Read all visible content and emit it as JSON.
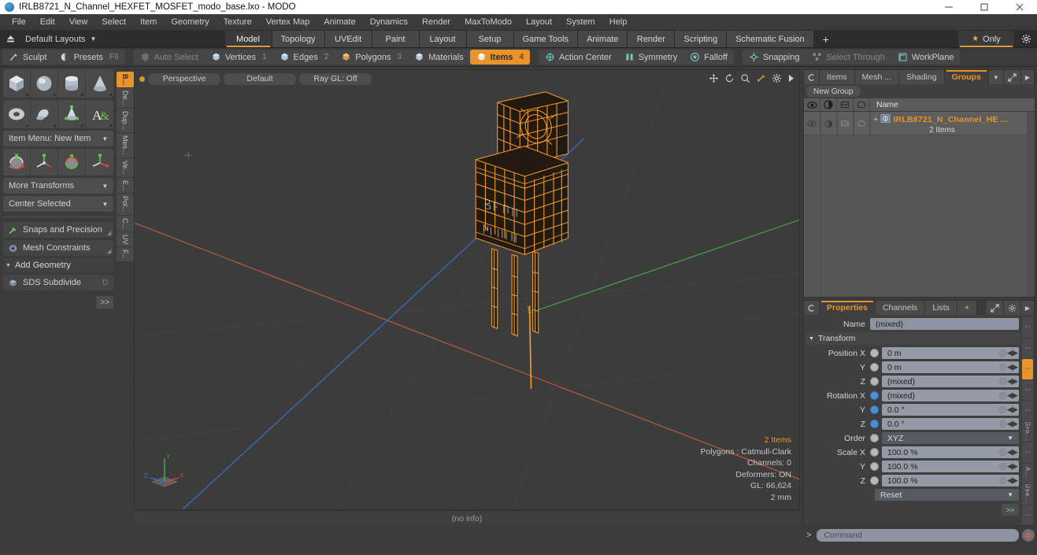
{
  "window": {
    "title": "IRLB8721_N_Channel_HEXFET_MOSFET_modo_base.lxo - MODO",
    "app_icon": "modo-logo-icon",
    "minimize": "minimize-icon",
    "maximize": "maximize-icon",
    "close": "close-icon"
  },
  "menubar": {
    "items": [
      "File",
      "Edit",
      "View",
      "Select",
      "Item",
      "Geometry",
      "Texture",
      "Vertex Map",
      "Animate",
      "Dynamics",
      "Render",
      "MaxToModo",
      "Layout",
      "System",
      "Help"
    ]
  },
  "layout_row": {
    "up_icon": "eject-icon",
    "default_layouts": "Default Layouts",
    "tabs": [
      {
        "label": "Model",
        "active": true
      },
      {
        "label": "Topology",
        "active": false
      },
      {
        "label": "UVEdit",
        "active": false
      },
      {
        "label": "Paint",
        "active": false
      },
      {
        "label": "Layout",
        "active": false
      },
      {
        "label": "Setup",
        "active": false
      },
      {
        "label": "Game Tools",
        "active": false
      },
      {
        "label": "Animate",
        "active": false
      },
      {
        "label": "Render",
        "active": false
      },
      {
        "label": "Scripting",
        "active": false
      },
      {
        "label": "Schematic Fusion",
        "active": false
      }
    ],
    "add_tab": "+",
    "only_label": "Only",
    "star_icon": "star-icon",
    "gear_icon": "gear-icon"
  },
  "toolbar": {
    "left_group": [
      {
        "label": "Sculpt",
        "icon": "brush-icon",
        "state": "normal",
        "shortcut": ""
      },
      {
        "label": "Presets",
        "icon": "sphere-half-icon",
        "state": "normal",
        "shortcut": "F6"
      }
    ],
    "select_modes": [
      {
        "label": "Auto Select",
        "icon": "shield-icon",
        "state": "dim",
        "shortcut": ""
      },
      {
        "label": "Vertices",
        "icon": "cube-icon",
        "state": "normal",
        "shortcut": "1"
      },
      {
        "label": "Edges",
        "icon": "cube-icon",
        "state": "normal",
        "shortcut": "2"
      },
      {
        "label": "Polygons",
        "icon": "cube-icon",
        "state": "normal",
        "shortcut": "3"
      },
      {
        "label": "Materials",
        "icon": "cube-icon",
        "state": "normal",
        "shortcut": ""
      },
      {
        "label": "Items",
        "icon": "cube-icon",
        "state": "selected",
        "shortcut": "4"
      }
    ],
    "right_group": [
      {
        "label": "Action Center",
        "icon": "crosshair-icon",
        "state": "normal"
      },
      {
        "label": "Symmetry",
        "icon": "symmetry-icon",
        "state": "normal"
      },
      {
        "label": "Falloff",
        "icon": "target-icon",
        "state": "normal"
      },
      {
        "label": "Snapping",
        "icon": "magnet-icon",
        "state": "normal"
      },
      {
        "label": "Select Through",
        "icon": "select-through-icon",
        "state": "dim"
      },
      {
        "label": "WorkPlane",
        "icon": "workplane-icon",
        "state": "normal"
      }
    ]
  },
  "left_panel": {
    "primitives": [
      {
        "name": "cube-tool",
        "icon": "cube-icon"
      },
      {
        "name": "sphere-tool",
        "icon": "sphere-icon"
      },
      {
        "name": "cylinder-tool",
        "icon": "cylinder-icon"
      },
      {
        "name": "cone-tool",
        "icon": "cone-icon"
      },
      {
        "name": "torus-tool",
        "icon": "torus-icon"
      },
      {
        "name": "capsule-tool",
        "icon": "capsule-icon"
      },
      {
        "name": "teapot-tool",
        "icon": "teapot-icon"
      },
      {
        "name": "text-tool",
        "icon": "text-icon"
      }
    ],
    "item_menu": "Item Menu: New Item",
    "transforms": [
      {
        "name": "move-tool",
        "icon": "move-gizmo-icon"
      },
      {
        "name": "rotate-tool",
        "icon": "rotate-gizmo-icon"
      },
      {
        "name": "scale-tool",
        "icon": "scale-gizmo-icon"
      },
      {
        "name": "transform-tool",
        "icon": "transform-gizmo-icon"
      }
    ],
    "more_transforms": "More Transforms",
    "center_selected": "Center Selected",
    "snaps_and_precision": "Snaps and Precision",
    "mesh_constraints": "Mesh Constraints",
    "add_geometry": "Add Geometry",
    "sds_subdivide": "SDS Subdivide",
    "sds_shortcut": "D",
    "expand_button": ">>",
    "vertical_tabs": [
      {
        "label": "B...",
        "active": true
      },
      {
        "label": "De...",
        "active": false
      },
      {
        "label": "Dup...",
        "active": false
      },
      {
        "label": "Mes...",
        "active": false
      },
      {
        "label": "Ve...",
        "active": false
      },
      {
        "label": "E...",
        "active": false
      },
      {
        "label": "Pol...",
        "active": false
      },
      {
        "label": "C...",
        "active": false
      },
      {
        "label": "UV",
        "active": false
      },
      {
        "label": "F...",
        "active": false
      }
    ]
  },
  "viewport": {
    "view_mode": "Perspective",
    "shading": "Default",
    "raygl": "Ray GL: Off",
    "nav_icons": [
      "pan-icon",
      "rotate-icon",
      "zoom-icon",
      "fit-icon",
      "gear-icon",
      "play-icon"
    ],
    "info": {
      "items": "2 Items",
      "polygons": "Polygons : Catmull-Clark",
      "channels": "Channels: 0",
      "deformers": "Deformers: ON",
      "gl": "GL: 66,624",
      "scale": "2 mm"
    },
    "axis_gizmo": {
      "x": "X",
      "y": "Y",
      "z": "Z"
    },
    "colors": {
      "selection": "#f49b2b",
      "axis_x": "#c4483a",
      "axis_y": "#46a046",
      "axis_z": "#3b6fc4",
      "background": "#3c3c3c"
    },
    "status": "(no info)"
  },
  "right_panel": {
    "top_tabs": [
      {
        "label": "Items",
        "active": false
      },
      {
        "label": "Mesh ...",
        "active": false
      },
      {
        "label": "Shading",
        "active": false
      },
      {
        "label": "Groups",
        "active": true
      }
    ],
    "new_group_button": "New Group",
    "list_columns": [
      {
        "icon": "eye-icon"
      },
      {
        "icon": "render-icon"
      },
      {
        "icon": "wireframe-icon"
      },
      {
        "icon": "shaded-icon"
      }
    ],
    "name_column": "Name",
    "item": {
      "name": "IRLB8721_N_Channel_HE ...",
      "sub": "2 Items",
      "icon": "group-icon",
      "expand": "+"
    },
    "prop_tabs": [
      {
        "label": "Properties",
        "active": true
      },
      {
        "label": "Channels",
        "active": false
      },
      {
        "label": "Lists",
        "active": false
      },
      {
        "label": "+",
        "active": false
      }
    ],
    "prop_icons": [
      "expand-icon",
      "gear-icon",
      "arrow-right-icon"
    ],
    "properties": {
      "name_label": "Name",
      "name_value": "(mixed)",
      "transform_section": "Transform",
      "rows": [
        {
          "label": "Position X",
          "value": "0 m",
          "dot": "grey"
        },
        {
          "label": "Y",
          "value": "0 m",
          "dot": "grey"
        },
        {
          "label": "Z",
          "value": "(mixed)",
          "dot": "grey"
        },
        {
          "label": "Rotation X",
          "value": "(mixed)",
          "dot": "blue"
        },
        {
          "label": "Y",
          "value": "0.0 °",
          "dot": "blue"
        },
        {
          "label": "Z",
          "value": "0.0 °",
          "dot": "blue"
        }
      ],
      "order_label": "Order",
      "order_value": "XYZ",
      "scale_rows": [
        {
          "label": "Scale X",
          "value": "100.0 %",
          "dot": "grey"
        },
        {
          "label": "Y",
          "value": "100.0 %",
          "dot": "grey"
        },
        {
          "label": "Z",
          "value": "100.0 %",
          "dot": "grey"
        }
      ],
      "reset": "Reset",
      "expand_button": ">>"
    },
    "vertical_tabs": [
      {
        "label": "⋮",
        "active": false
      },
      {
        "label": "⋮",
        "active": false
      },
      {
        "label": "⋮",
        "active": true
      },
      {
        "label": "⋮",
        "active": false
      },
      {
        "label": "⋮",
        "active": false
      },
      {
        "label": "Gro...",
        "active": false
      },
      {
        "label": "⋮",
        "active": false
      },
      {
        "label": "A...",
        "active": false
      },
      {
        "label": "Use...",
        "active": false
      },
      {
        "label": "⋮",
        "active": false
      }
    ]
  },
  "command_bar": {
    "prompt": ">",
    "placeholder": "Command",
    "record_icon": "record-icon"
  }
}
